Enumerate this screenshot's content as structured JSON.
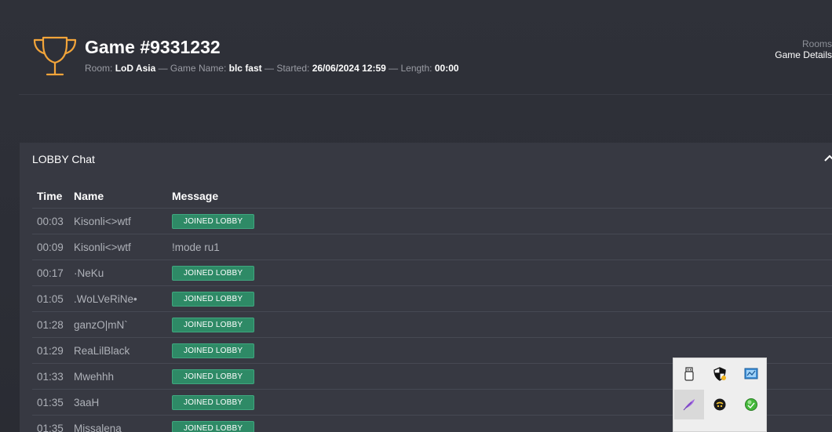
{
  "game": {
    "title": "Game #9331232",
    "room_label": "Room:",
    "room": "LoD Asia",
    "name_label": "— Game Name:",
    "name": "blc fast",
    "started_label": "— Started:",
    "started": "26/06/2024 12:59",
    "length_label": "— Length:",
    "length": "00:00"
  },
  "breadcrumb": {
    "rooms": "Rooms",
    "current": "Game Details"
  },
  "lobby": {
    "title": "LOBBY Chat",
    "columns": {
      "time": "Time",
      "name": "Name",
      "message": "Message"
    },
    "rows": [
      {
        "time": "00:03",
        "name": "Kisonli<>wtf",
        "message": "JOINED LOBBY",
        "badge": true
      },
      {
        "time": "00:09",
        "name": "Kisonli<>wtf",
        "message": "!mode ru1",
        "badge": false
      },
      {
        "time": "00:17",
        "name": "·NeKu",
        "message": "JOINED LOBBY",
        "badge": true
      },
      {
        "time": "01:05",
        "name": ".WoLVeRiNe•",
        "message": "JOINED LOBBY",
        "badge": true
      },
      {
        "time": "01:28",
        "name": "ganzO|mN`",
        "message": "JOINED LOBBY",
        "badge": true
      },
      {
        "time": "01:29",
        "name": "ReaLilBlack",
        "message": "JOINED LOBBY",
        "badge": true
      },
      {
        "time": "01:33",
        "name": "Mwehhh",
        "message": "JOINED LOBBY",
        "badge": true
      },
      {
        "time": "01:35",
        "name": "3aaH",
        "message": "JOINED LOBBY",
        "badge": true
      },
      {
        "time": "01:35",
        "name": "Missalena",
        "message": "JOINED LOBBY",
        "badge": true
      }
    ]
  },
  "tray": {
    "icons": [
      "usb-drive-icon",
      "security-shield-icon",
      "network-monitor-icon",
      "feather-icon",
      "game-client-icon",
      "green-globe-icon"
    ]
  },
  "colors": {
    "accent": "#f2a43a",
    "badge": "#2e8a66",
    "panel": "#373942",
    "background": "#2e3038"
  }
}
